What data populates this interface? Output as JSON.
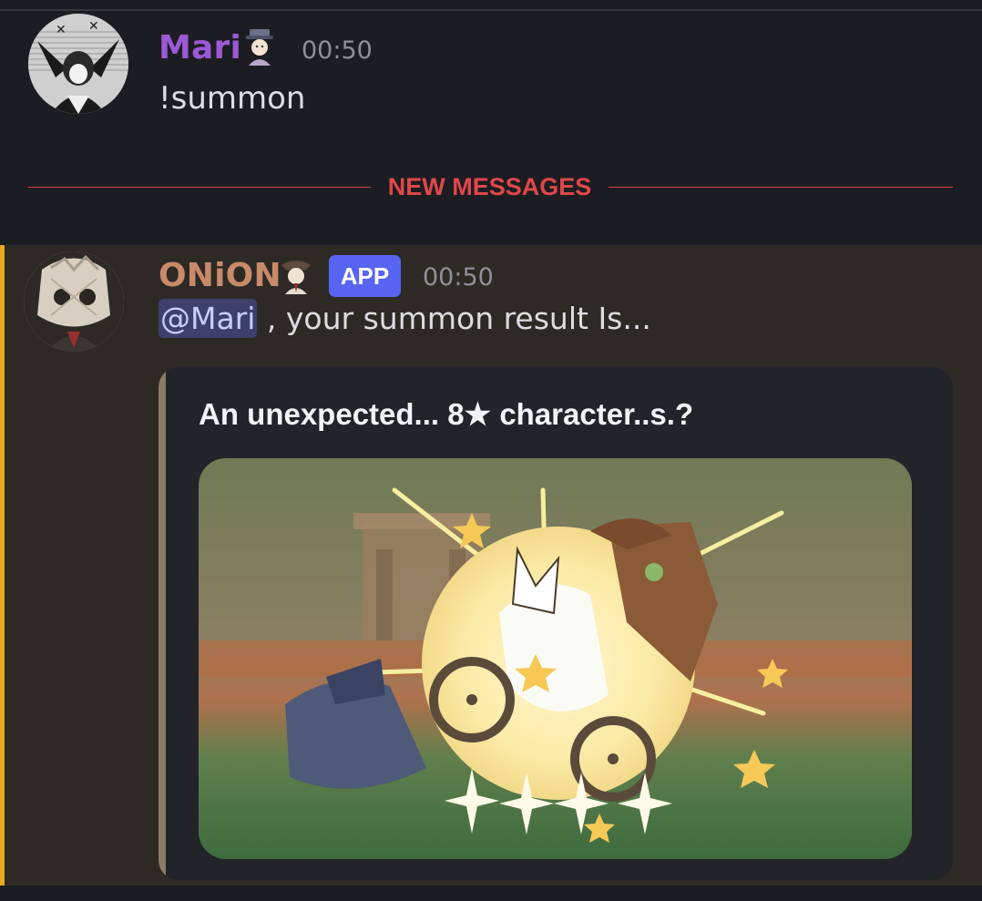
{
  "messages": [
    {
      "author": "Mari",
      "time": "00:50",
      "content": "!summon",
      "author_color": "#9b59d6",
      "badge_icon": "person-emoji-icon"
    },
    {
      "author": "ONiON",
      "time": "00:50",
      "badge": "APP",
      "mention": "@Mari",
      "content": " , your summon result Is...",
      "author_color": "#c98a6a",
      "badge_icon": "person-emoji-icon",
      "embed": {
        "title": "An unexpected... 8★ character..s.?",
        "image_icon": "summon-result-image"
      }
    }
  ],
  "divider": {
    "label": "NEW MESSAGES",
    "color": "#e0474a"
  },
  "colors": {
    "background": "#1c1d22",
    "highlight_background": "#2d2a26",
    "mention_bar": "#e6a91f",
    "app_badge": "#5865f2",
    "mention_bg": "#3e3f6b"
  }
}
